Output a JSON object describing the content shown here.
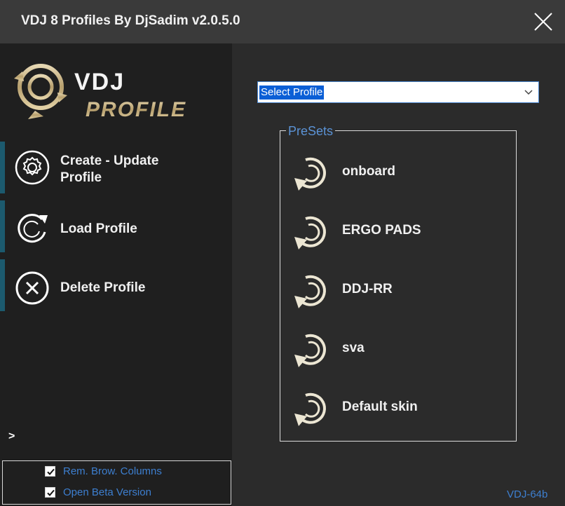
{
  "window": {
    "title": "VDJ 8 Profiles By DjSadim v2.0.5.0"
  },
  "logo": {
    "line1": "VDJ",
    "line2": "PROFILE"
  },
  "sidebar": {
    "items": [
      {
        "line1": "Create - Update",
        "line2": "Profile",
        "icon": "gear-icon"
      },
      {
        "line1": "Load Profile",
        "icon": "reload-icon"
      },
      {
        "line1": "Delete Profile",
        "icon": "delete-circle-icon"
      }
    ],
    "expand_label": ">"
  },
  "options": {
    "items": [
      {
        "label": "Rem. Brow. Columns",
        "checked": true
      },
      {
        "label": "Open Beta Version",
        "checked": true
      }
    ]
  },
  "profile_select": {
    "value": "Select Profile"
  },
  "presets": {
    "legend": "PreSets",
    "items": [
      {
        "label": "onboard"
      },
      {
        "label": "ERGO PADS"
      },
      {
        "label": "DDJ-RR"
      },
      {
        "label": "sva"
      },
      {
        "label": "Default skin"
      }
    ]
  },
  "footer": {
    "version_tag": "VDJ-64b"
  },
  "colors": {
    "titlebar": "#3a3a3a",
    "sidebar": "#1f1f1f",
    "main": "#2b2b2b",
    "accent_bar": "#1c5a6e",
    "link_blue": "#3d7fd0",
    "selection_blue": "#0b5fd6",
    "logo_gold": "#c9b48a"
  }
}
